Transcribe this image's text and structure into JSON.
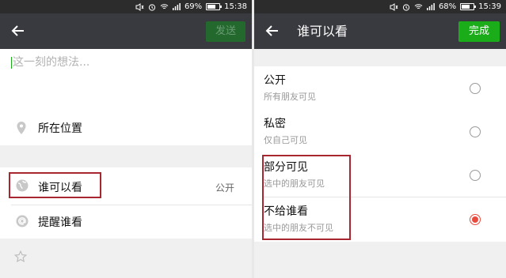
{
  "left": {
    "status": {
      "battery": "69%",
      "battery_level": 0.69,
      "time": "15:38"
    },
    "topbar": {
      "send_label": "发送"
    },
    "compose": {
      "placeholder": "这一刻的想法..."
    },
    "rows": {
      "location_label": "所在位置",
      "who_can_see_label": "谁可以看",
      "who_can_see_value": "公开",
      "remind_label": "提醒谁看"
    }
  },
  "right": {
    "status": {
      "battery": "68%",
      "battery_level": 0.68,
      "time": "15:39"
    },
    "topbar": {
      "title": "谁可以看",
      "done_label": "完成"
    },
    "options": [
      {
        "title": "公开",
        "subtitle": "所有朋友可见",
        "selected": false
      },
      {
        "title": "私密",
        "subtitle": "仅自己可见",
        "selected": false
      },
      {
        "title": "部分可见",
        "subtitle": "选中的朋友可见",
        "selected": false
      },
      {
        "title": "不给谁看",
        "subtitle": "选中的朋友不可见",
        "selected": true
      }
    ]
  },
  "colors": {
    "accent_green": "#1aad19",
    "highlight_red": "#a8262f",
    "radio_selected": "#e84a3c",
    "topbar": "#393a3f"
  }
}
